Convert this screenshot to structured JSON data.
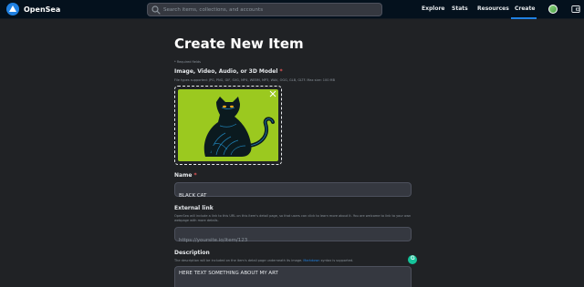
{
  "header": {
    "brand": "OpenSea",
    "search_placeholder": "Search items, collections, and accounts",
    "nav": [
      "Explore",
      "Stats",
      "Resources",
      "Create"
    ],
    "active_nav": "Create"
  },
  "page": {
    "title": "Create New Item",
    "required_note": "* Required fields",
    "media": {
      "label": "Image, Video, Audio, or 3D Model",
      "required_star": "*",
      "help": "File types supported: JPG, PNG, GIF, SVG, MP4, WEBM, MP3, WAV, OGG, GLB, GLTF. Max size: 100 MB"
    },
    "name": {
      "label": "Name",
      "required_star": "*",
      "value": "BLACK CAT"
    },
    "external_link": {
      "label": "External link",
      "help": "OpenSea will include a link to this URL on this item's detail page, so that users can click to learn more about it. You are welcome to link to your own webpage with more details.",
      "placeholder": "https://yoursite.io/item/123"
    },
    "description": {
      "label": "Description",
      "help_before": "The description will be included on the item's detail page underneath its image.",
      "help_link": "Markdown",
      "help_after": "syntax is supported.",
      "value": "HERE TEXT SOMETHING ABOUT MY ART"
    }
  },
  "colors": {
    "background": "#202225",
    "header": "#04111d",
    "accent": "#2081e2",
    "required": "#eb5757",
    "artwork_bg": "#9bc91f"
  },
  "icons": {
    "brand": "opensea-logo-icon",
    "search": "search-icon",
    "close": "close-icon",
    "account": "avatar",
    "wallet": "wallet-icon",
    "grammarly": "grammarly-icon"
  }
}
